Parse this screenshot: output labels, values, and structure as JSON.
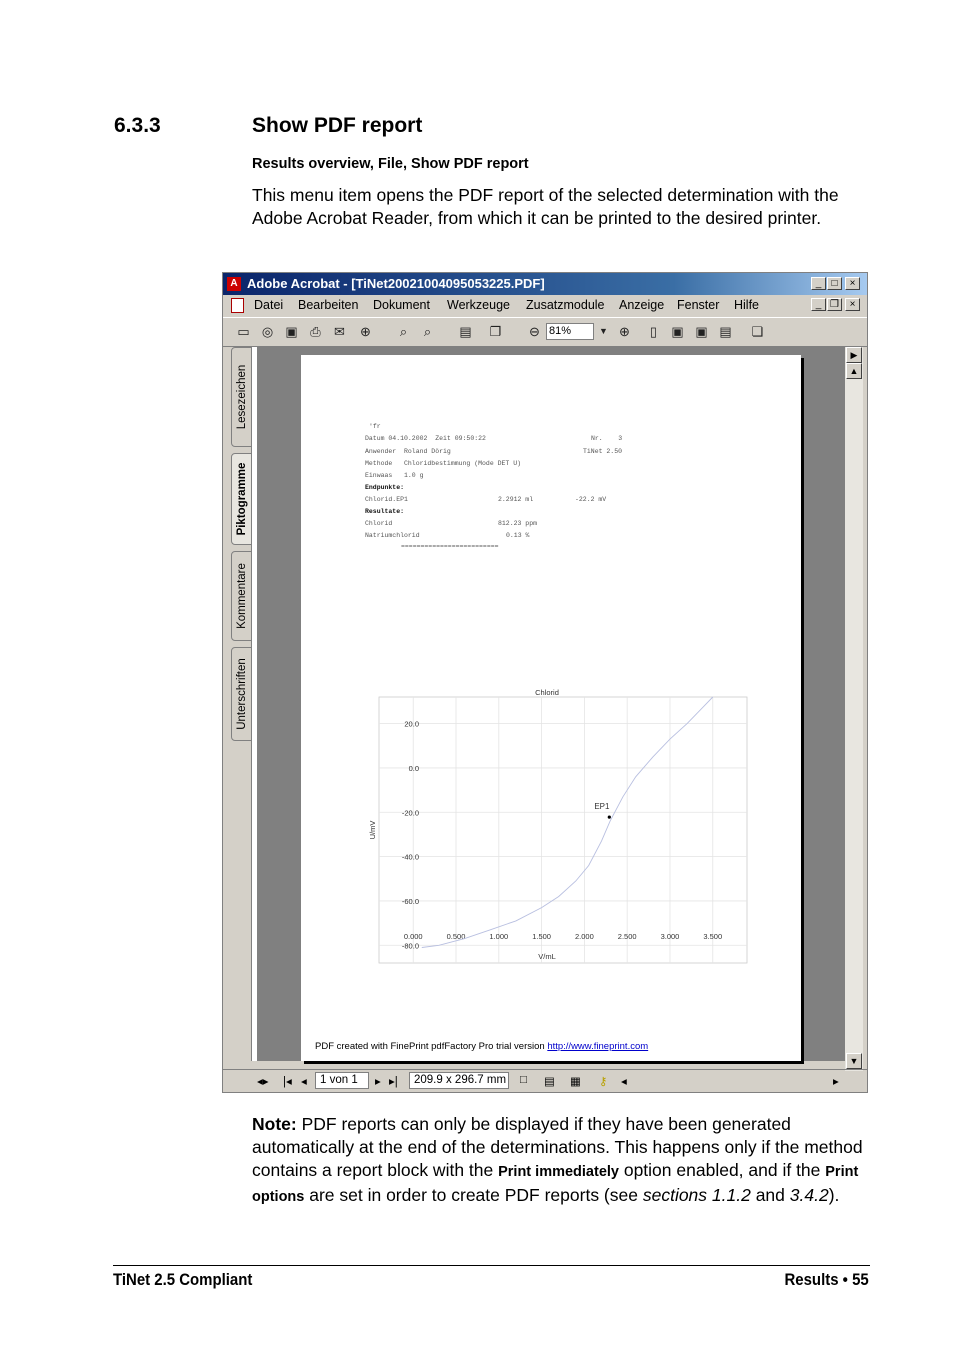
{
  "section": {
    "number": "6.3.3",
    "title": "Show PDF report"
  },
  "menu_path": "Results overview, File, Show PDF report",
  "intro": "This menu item opens the PDF report of the selected determination with the Adobe Acrobat Reader, from which it can be printed to the desired printer.",
  "acrobat": {
    "title": "Adobe Acrobat - [TiNet20021004095053225.PDF]",
    "menu": [
      "Datei",
      "Bearbeiten",
      "Dokument",
      "Werkzeuge",
      "Zusatzmodule",
      "Anzeige",
      "Fenster",
      "Hilfe"
    ],
    "zoom": "81%",
    "tabs": [
      "Lesezeichen",
      "Piktogramme",
      "Kommentare",
      "Unterschriften"
    ],
    "page_counter": "1 von 1",
    "page_size": "209.9 x 296.7 mm",
    "report": {
      "line0": "'fr",
      "line1": "Datum 04.10.2002  Zeit 09:50:22",
      "line1r": "Nr.    3",
      "line2": "Anwender  Roland Dörig",
      "line2r": "TiNet 2.50",
      "line3": "Methode   Chloridbestimmung (Mode DET U)",
      "line4": "Einwaas   1.0 g",
      "endpoints_label": "Endpunkte:",
      "ep_row": [
        "Chlorid.EP1",
        "2.2912 ml",
        "-22.2 mV"
      ],
      "results_label": "Resultate:",
      "res_rows": [
        [
          "Chlorid",
          "812.23 ppm"
        ],
        [
          "Natriumchlorid",
          "0.13 %"
        ]
      ],
      "sep": "========================="
    },
    "pdf_note": "PDF created with FinePrint pdfFactory Pro trial version ",
    "pdf_link": "http://www.fineprint.com"
  },
  "chart_data": {
    "type": "line",
    "title": "Chlorid",
    "xlabel": "V/mL",
    "ylabel": "U/mV",
    "xlim": [
      -0.4,
      3.9
    ],
    "ylim": [
      -88,
      32
    ],
    "xticks": [
      0.0,
      0.5,
      1.0,
      1.5,
      2.0,
      2.5,
      3.0,
      3.5
    ],
    "xtick_labels": [
      "0.000",
      "0.500",
      "1.000",
      "1.500",
      "2.000",
      "2.500",
      "3.000",
      "3.500"
    ],
    "yticks": [
      20,
      0,
      -20,
      -40,
      -60,
      -80
    ],
    "ytick_labels": [
      "20.0",
      "0.0",
      "-20.0",
      "-40.0",
      "-60.0",
      "-80.0"
    ],
    "grid": true,
    "series": [
      {
        "x": [
          0.1,
          0.3,
          0.6,
          0.9,
          1.2,
          1.5,
          1.7,
          1.9,
          2.05,
          2.2,
          2.3,
          2.45,
          2.6,
          2.8,
          3.0,
          3.2,
          3.4,
          3.5
        ],
        "y": [
          -81,
          -80,
          -77,
          -73,
          -69,
          -63,
          -58,
          -51,
          -44,
          -33,
          -24,
          -13,
          -4,
          5,
          13,
          20,
          28,
          32
        ]
      }
    ],
    "annotations": [
      {
        "label": "EP1",
        "x": 2.2912,
        "y": -22.2
      }
    ]
  },
  "note": {
    "label": "Note:",
    "t1": " PDF reports can only be displayed if they have been generated automatically at the end of the determinations. This happens only if the method contains a report block with the ",
    "opt1": "Print immediately",
    "t2": " option enabled, and if the ",
    "opt2": "Print options",
    "t3": " are set in order to create PDF reports (see ",
    "ref1": "sections 1.1.2",
    "t4": " and ",
    "ref2": "3.4.2",
    "t5": ")."
  },
  "footer": {
    "left": "TiNet 2.5 Compliant",
    "right": "Results  •  55"
  }
}
